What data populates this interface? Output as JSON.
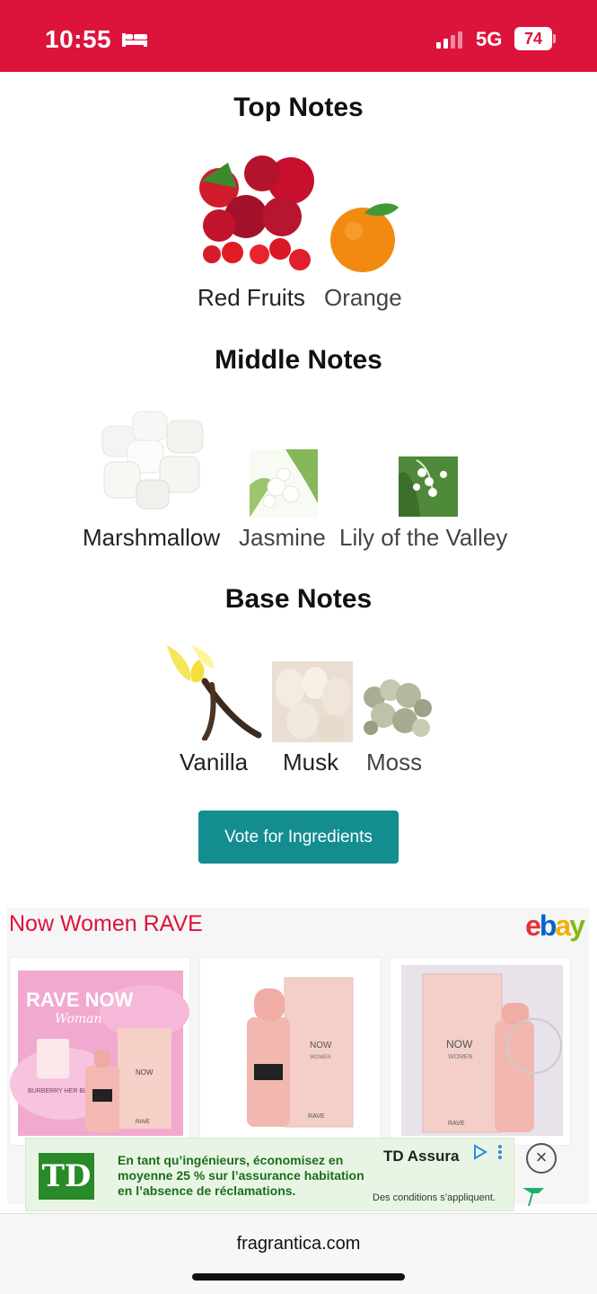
{
  "status_bar": {
    "time": "10:55",
    "network": "5G",
    "battery": "74"
  },
  "sections": {
    "top": {
      "title": "Top Notes",
      "items": [
        {
          "label": "Red Fruits"
        },
        {
          "label": "Orange"
        }
      ]
    },
    "middle": {
      "title": "Middle Notes",
      "items": [
        {
          "label": "Marshmallow"
        },
        {
          "label": "Jasmine"
        },
        {
          "label": "Lily of the Valley"
        }
      ]
    },
    "base": {
      "title": "Base Notes",
      "items": [
        {
          "label": "Vanilla"
        },
        {
          "label": "Musk"
        },
        {
          "label": "Moss"
        }
      ]
    }
  },
  "vote_button": "Vote for Ingredients",
  "ebay": {
    "title": "Now Women RAVE",
    "logo": [
      "e",
      "b",
      "a",
      "y"
    ],
    "product1": {
      "banner": "RAVE NOW",
      "sub": "Woman",
      "tag": "BURBERRY HER BLOSSOM",
      "brand": "RAVE",
      "box": "NOW"
    },
    "product2": {
      "box": "NOW",
      "sub": "WOMEN",
      "brand": "RAVE"
    },
    "product3": {
      "box": "NOW",
      "sub": "WOMEN",
      "brand": "RAVE"
    }
  },
  "ad": {
    "text": "En tant qu’ingénieurs, économisez en moyenne 25 % sur l’assurance habitation en l’absence de réclamations.",
    "brand": "TD Assura",
    "conditions": "Des conditions s’appliquent.",
    "logo": "TD"
  },
  "url": "fragrantica.com",
  "colors": {
    "accent_red": "#dc143c",
    "teal": "#138d90",
    "td_green": "#2a8a2a"
  }
}
